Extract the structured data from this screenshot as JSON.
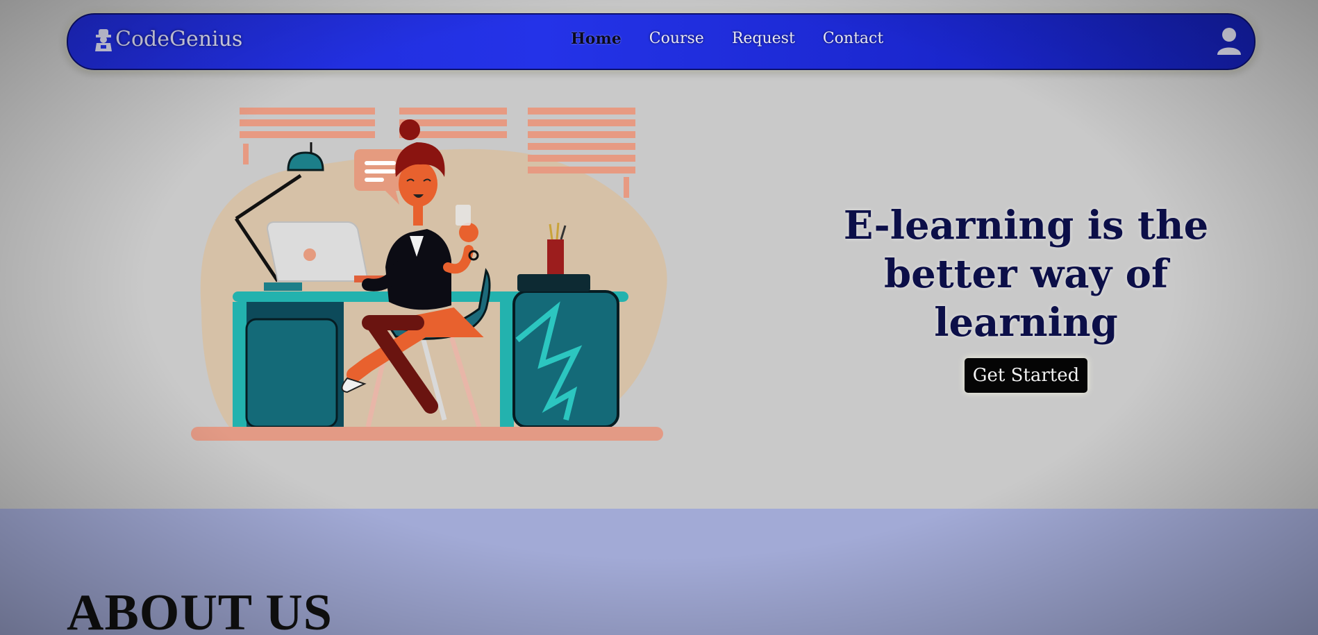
{
  "brand": {
    "name": "CodeGenius",
    "icon": "coder-logo-icon"
  },
  "nav": {
    "items": [
      {
        "label": "Home",
        "active": true
      },
      {
        "label": "Course",
        "active": false
      },
      {
        "label": "Request",
        "active": false
      },
      {
        "label": "Contact",
        "active": false
      }
    ],
    "user_icon": "user-icon"
  },
  "hero": {
    "title": "E-learning is the better way of learning",
    "cta_label": "Get Started",
    "illustration": "woman-working-at-desk-illustration"
  },
  "about": {
    "title": "ABOUT US"
  },
  "colors": {
    "navbar": "#2433e8",
    "hero_bg": "#c9c9c9",
    "hero_title": "#0c0f48",
    "cta_bg": "#050505",
    "about_bg": "#a2aad6"
  }
}
